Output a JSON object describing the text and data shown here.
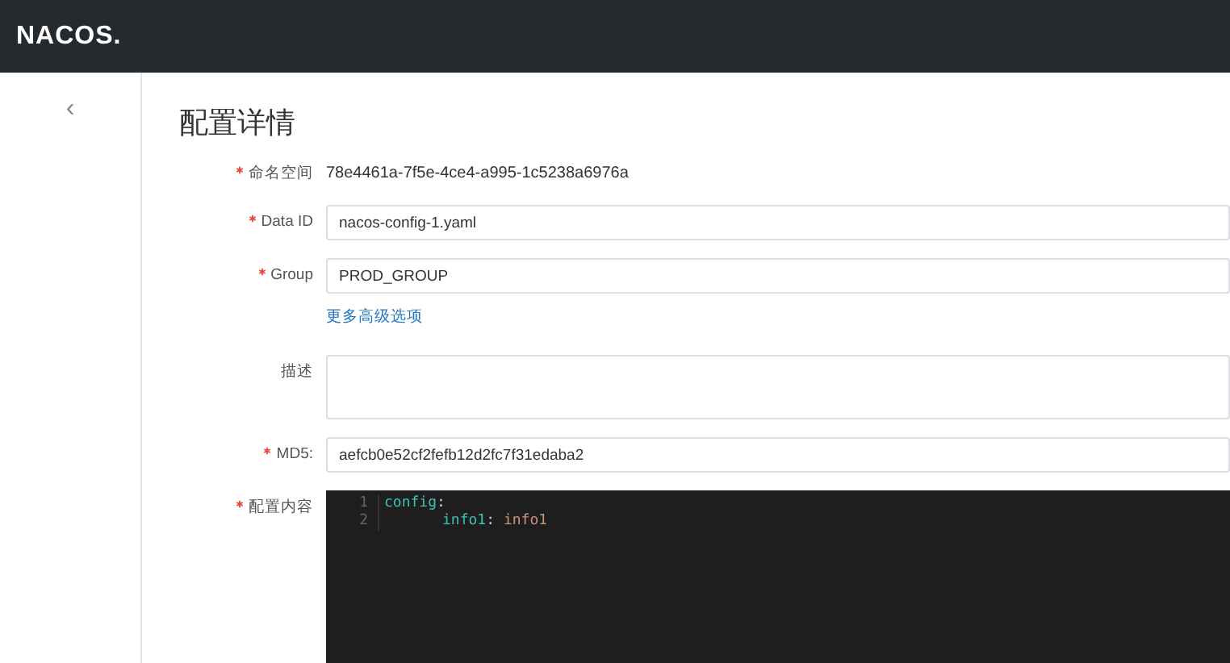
{
  "header": {
    "logo": "NACOS."
  },
  "sidebar": {
    "collapse": "‹"
  },
  "page": {
    "title": "配置详情"
  },
  "form": [
    {
      "kind": "text",
      "label": "命名空间",
      "required": true,
      "value": "78e4461a-7f5e-4ce4-a995-1c5238a6976a"
    },
    {
      "kind": "input",
      "label": "Data ID",
      "required": true,
      "value": "nacos-config-1.yaml"
    },
    {
      "kind": "input",
      "label": "Group",
      "required": true,
      "value": "PROD_GROUP"
    },
    {
      "kind": "link",
      "value": "更多高级选项"
    },
    {
      "kind": "textarea",
      "label": "描述",
      "required": false
    },
    {
      "kind": "input",
      "label": "MD5:",
      "required": true,
      "value": "aefcb0e52cf2fefb12d2fc7f31edaba2"
    },
    {
      "kind": "editor",
      "label": "配置内容",
      "required": true,
      "lines": [
        {
          "number": "1",
          "tokens": [
            {
              "text": "config",
              "kind": "key"
            },
            {
              "text": ":",
              "kind": "punct"
            }
          ],
          "children": [
            {
              "number": "2",
              "tokens": [
                {
                  "text": "info1",
                  "kind": "key"
                },
                {
                  "text": ":",
                  "kind": "punct"
                },
                {
                  "text": "info1",
                  "kind": "value"
                }
              ]
            }
          ]
        }
      ]
    }
  ]
}
